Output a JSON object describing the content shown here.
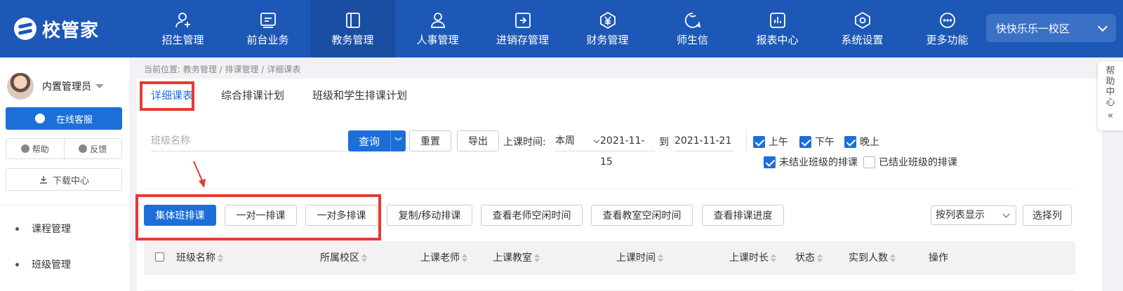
{
  "app": {
    "logo_text": "校管家"
  },
  "nav": {
    "items": [
      {
        "label": "招生管理",
        "icon": "user-add-icon"
      },
      {
        "label": "前台业务",
        "icon": "monitor-icon"
      },
      {
        "label": "教务管理",
        "icon": "book-icon",
        "active": true
      },
      {
        "label": "人事管理",
        "icon": "person-icon"
      },
      {
        "label": "进销存管理",
        "icon": "inventory-icon"
      },
      {
        "label": "财务管理",
        "icon": "yuan-icon"
      },
      {
        "label": "师生信",
        "icon": "chat-icon"
      },
      {
        "label": "报表中心",
        "icon": "chart-icon"
      },
      {
        "label": "系统设置",
        "icon": "settings-icon"
      },
      {
        "label": "更多功能",
        "icon": "more-icon"
      }
    ],
    "campus": "快快乐乐一校区"
  },
  "sidebar": {
    "user_name": "内置管理员",
    "online_service": "在线客服",
    "help": "帮助",
    "feedback": "反馈",
    "download_center": "下载中心",
    "menu": [
      "课程管理",
      "班级管理"
    ]
  },
  "breadcrumb": "当前位置: 教务管理 / 排课管理 / 详细课表",
  "tabs": [
    "详细课表",
    "综合排课计划",
    "班级和学生排课计划"
  ],
  "filters": {
    "class_name_placeholder": "班级名称",
    "query": "查询",
    "reset": "重置",
    "export": "导出",
    "time_label": "上课时间:",
    "week": "本周",
    "date_from": "2021-11-15",
    "to": "到",
    "date_to": "2021-11-21",
    "morning": "上午",
    "afternoon": "下午",
    "evening": "晚上",
    "unfinished_classes": "未结业班级的排课",
    "finished_classes": "已结业班级的排课"
  },
  "actions": {
    "group_schedule": "集体班排课",
    "one_on_one": "一对一排课",
    "one_to_many": "一对多排课",
    "copy_move": "复制/移动排课",
    "teacher_free": "查看老师空闲时间",
    "room_free": "查看教室空闲时间",
    "progress": "查看排课进度",
    "view_mode": "按列表显示",
    "select_columns": "选择列"
  },
  "table": {
    "headers": [
      "班级名称",
      "所属校区",
      "上课老师",
      "上课教室",
      "上课时间",
      "上课时长",
      "状态",
      "实到人数",
      "操作"
    ]
  },
  "help_center": {
    "label": [
      "帮",
      "助",
      "中",
      "心"
    ],
    "collapse": "«"
  },
  "colors": {
    "nav_bg": "#1d58b6",
    "accent": "#1d6fd8",
    "highlight": "#e53935"
  }
}
